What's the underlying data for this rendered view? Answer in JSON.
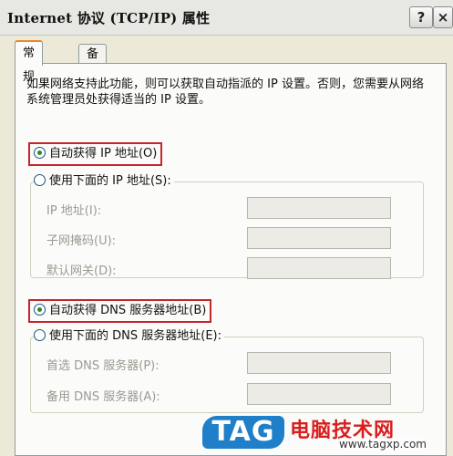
{
  "window": {
    "title": "Internet 协议 (TCP/IP) 属性",
    "help_button": "?",
    "close_button": "×"
  },
  "tabs": [
    {
      "label": "常规",
      "active": true
    },
    {
      "label": "备用配置",
      "active": false
    }
  ],
  "description": "如果网络支持此功能，则可以获取自动指派的 IP 设置。否则，您需要从网络系统管理员处获得适当的 IP 设置。",
  "ip": {
    "auto_label": "自动获得 IP 地址(O)",
    "auto_selected": true,
    "manual_label": "使用下面的 IP 地址(S):",
    "manual_selected": false,
    "fields": [
      {
        "label": "IP 地址(I):",
        "value": ""
      },
      {
        "label": "子网掩码(U):",
        "value": ""
      },
      {
        "label": "默认网关(D):",
        "value": ""
      }
    ]
  },
  "dns": {
    "auto_label": "自动获得 DNS 服务器地址(B)",
    "auto_selected": true,
    "manual_label": "使用下面的 DNS 服务器地址(E):",
    "manual_selected": false,
    "fields": [
      {
        "label": "首选 DNS 服务器(P):",
        "value": ""
      },
      {
        "label": "备用 DNS 服务器(A):",
        "value": ""
      }
    ]
  },
  "watermark": {
    "logo": "TAG",
    "site_name": "电脑技术网",
    "url": "www.tagxp.com"
  },
  "colors": {
    "highlight_box": "#c4262e",
    "watermark_blue": "#1f7fc8",
    "watermark_red": "#d81e1e"
  }
}
